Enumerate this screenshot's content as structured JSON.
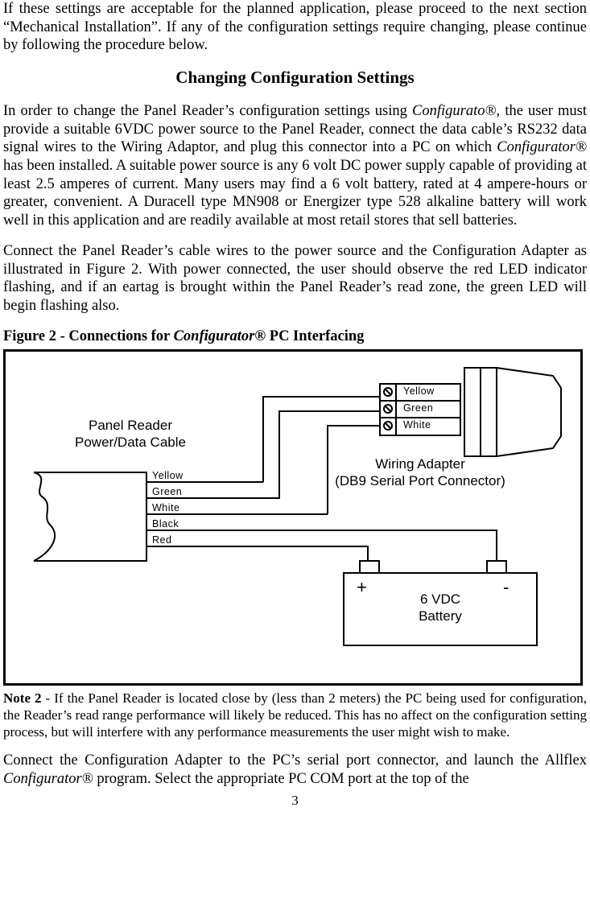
{
  "intro_para": "If these settings are acceptable for the planned application, please proceed to the next section “Mechanical Installation”.  If any of the configuration settings require changing, please continue by following the procedure below.",
  "section_heading": "Changing Configuration Settings",
  "para2a": "In order to change the Panel Reader’s configuration settings using ",
  "para2b": "Configurato®",
  "para2c": ", the user must provide a suitable 6VDC power source to the Panel Reader, connect the data cable’s RS232 data signal wires to the Wiring Adaptor, and plug this connector into a PC on which ",
  "para2d": "Configurator®",
  "para2e": " has been installed.  A suitable power source is any 6 volt DC power supply capable of providing at least 2.5 amperes of current.  Many users may find a 6 volt battery, rated at 4 ampere-hours or greater, convenient.  A Duracell type MN908 or Energizer type 528 alkaline battery will work well in this application and are readily available at most retail stores that sell batteries.",
  "para3": "Connect the Panel Reader’s cable wires to the power source and the Configuration Adapter as illustrated in Figure 2.  With power connected, the user should observe the red LED indicator flashing, and if an eartag is brought within the Panel Reader’s read zone, the green LED will begin flashing also.",
  "fig_label_a": "Figure 2",
  "fig_label_sep": "  -  ",
  "fig_label_b": "Connections for ",
  "fig_label_c": "Configurator®",
  "fig_label_d": " PC Interfacing",
  "diagram": {
    "panel_reader_l1": "Panel Reader",
    "panel_reader_l2": "Power/Data Cable",
    "wire_yellow": "Yellow",
    "wire_green": "Green",
    "wire_white": "White",
    "wire_black": "Black",
    "wire_red": "Red",
    "adapter_yellow": "Yellow",
    "adapter_green": "Green",
    "adapter_white": "White",
    "adapter_l1": "Wiring Adapter",
    "adapter_l2": "(DB9 Serial Port Connector)",
    "batt_plus": "+",
    "batt_minus": "-",
    "batt_l1": "6 VDC",
    "batt_l2": "Battery"
  },
  "note_lead": "Note 2",
  "note_sep": "  -  ",
  "note_body": "If the Panel Reader is located close by (less than 2 meters) the PC being used for configuration, the Reader’s read range performance will likely be reduced.  This has no affect on the configuration setting process, but will interfere with any performance measurements the user might wish to make.",
  "para4a": "Connect the Configuration Adapter to the PC’s serial port connector, and launch the Allflex ",
  "para4b": "Configurator®",
  "para4c": " program.  Select the appropriate PC COM port at the top of the",
  "page_number": "3"
}
